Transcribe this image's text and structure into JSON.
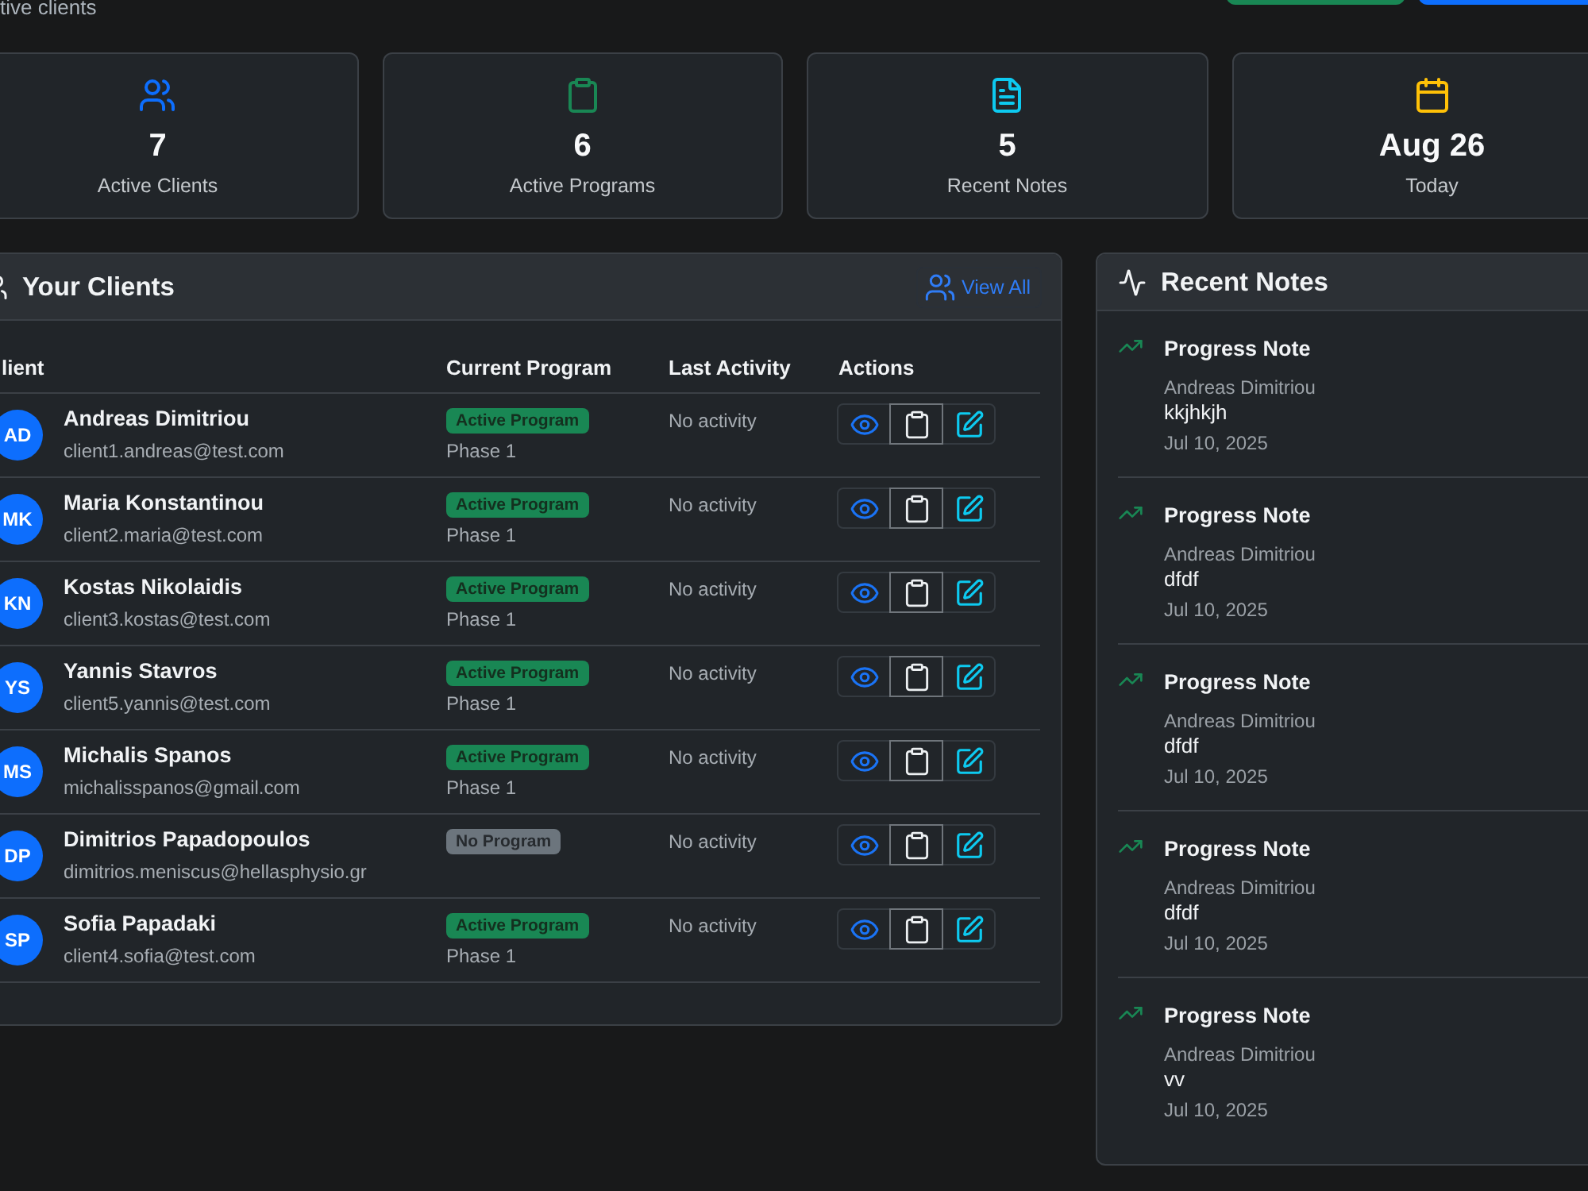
{
  "header": {
    "subtitle": "tive clients",
    "buttons": [
      {
        "kind": "success"
      },
      {
        "kind": "primary"
      }
    ]
  },
  "stats": [
    {
      "kind": "clients",
      "value": "7",
      "label": "Active Clients"
    },
    {
      "kind": "programs",
      "value": "6",
      "label": "Active Programs"
    },
    {
      "kind": "notes",
      "value": "5",
      "label": "Recent Notes"
    },
    {
      "kind": "date",
      "value": "Aug 26",
      "label": "Today"
    }
  ],
  "clients_panel": {
    "title": "Your Clients",
    "view_all": "View All",
    "columns": [
      "lient",
      "Current Program",
      "Last Activity",
      "Actions"
    ],
    "rows": [
      {
        "initials": "AD",
        "name": "Andreas Dimitriou",
        "email": "client1.andreas@test.com",
        "program": {
          "kind": "active",
          "label": "Active Program"
        },
        "phase": "Phase 1",
        "last_activity": "No activity"
      },
      {
        "initials": "MK",
        "name": "Maria Konstantinou",
        "email": "client2.maria@test.com",
        "program": {
          "kind": "active",
          "label": "Active Program"
        },
        "phase": "Phase 1",
        "last_activity": "No activity"
      },
      {
        "initials": "KN",
        "name": "Kostas Nikolaidis",
        "email": "client3.kostas@test.com",
        "program": {
          "kind": "active",
          "label": "Active Program"
        },
        "phase": "Phase 1",
        "last_activity": "No activity"
      },
      {
        "initials": "YS",
        "name": "Yannis Stavros",
        "email": "client5.yannis@test.com",
        "program": {
          "kind": "active",
          "label": "Active Program"
        },
        "phase": "Phase 1",
        "last_activity": "No activity"
      },
      {
        "initials": "MS",
        "name": "Michalis Spanos",
        "email": "michalisspanos@gmail.com",
        "program": {
          "kind": "active",
          "label": "Active Program"
        },
        "phase": "Phase 1",
        "last_activity": "No activity"
      },
      {
        "initials": "DP",
        "name": "Dimitrios Papadopoulos",
        "email": "dimitrios.meniscus@hellasphysio.gr",
        "program": {
          "kind": "none",
          "label": "No Program"
        },
        "last_activity": "No activity"
      },
      {
        "initials": "SP",
        "name": "Sofia Papadaki",
        "email": "client4.sofia@test.com",
        "program": {
          "kind": "active",
          "label": "Active Program"
        },
        "phase": "Phase 1",
        "last_activity": "No activity"
      }
    ]
  },
  "notes_panel": {
    "title": "Recent Notes",
    "notes": [
      {
        "title": "Progress Note",
        "client": "Andreas Dimitriou",
        "body": "kkjhkjh",
        "date": "Jul 10, 2025"
      },
      {
        "title": "Progress Note",
        "client": "Andreas Dimitriou",
        "body": "dfdf",
        "date": "Jul 10, 2025"
      },
      {
        "title": "Progress Note",
        "client": "Andreas Dimitriou",
        "body": "dfdf",
        "date": "Jul 10, 2025"
      },
      {
        "title": "Progress Note",
        "client": "Andreas Dimitriou",
        "body": "dfdf",
        "date": "Jul 10, 2025"
      },
      {
        "title": "Progress Note",
        "client": "Andreas Dimitriou",
        "body": "vv",
        "date": "Jul 10, 2025"
      }
    ]
  }
}
